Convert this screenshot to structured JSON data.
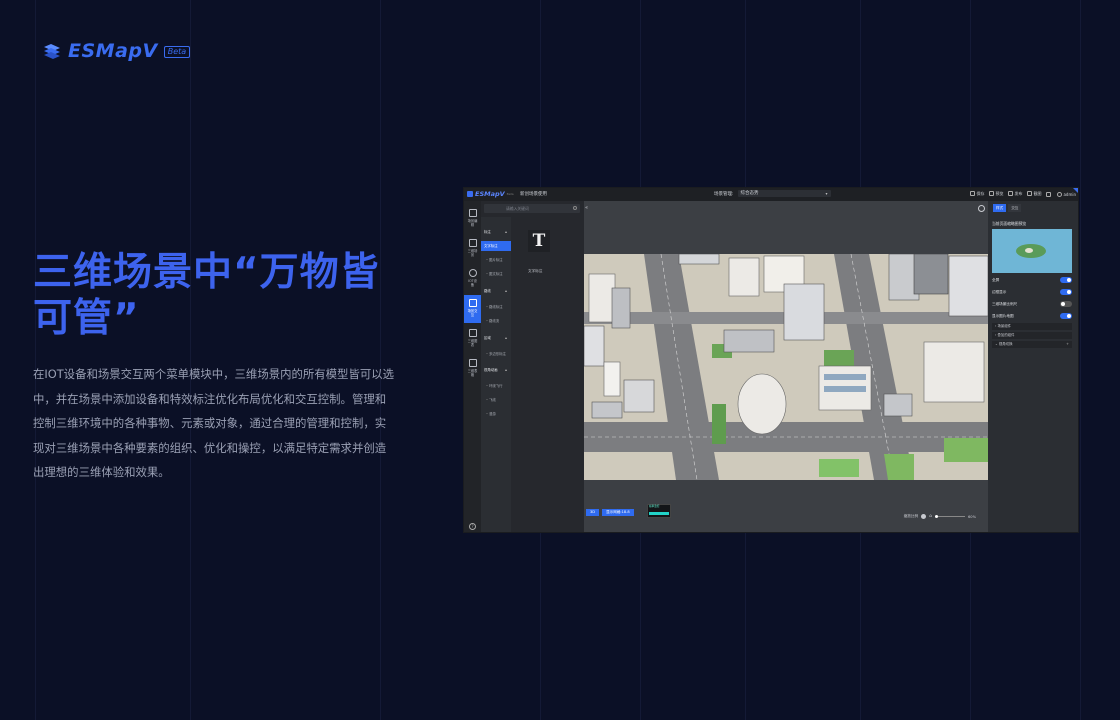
{
  "logo": {
    "name": "ESMapV",
    "badge": "Beta"
  },
  "headline": "三维场景中“万物皆可管”",
  "description": "在IOT设备和场景交互两个菜单模块中，三维场景内的所有模型皆可以选中，并在场景中添加设备和特效标注优化布局优化和交互控制。管理和控制三维环境中的各种事物、元素或对象，通过合理的管理和控制，实现对三维场景中各种要素的组织、优化和操控，以满足特定需求并创造出理想的三维体验和效果。",
  "colors": {
    "background": "#0b1026",
    "accent": "#3d63ee",
    "app_accent": "#2f6bf0"
  },
  "app": {
    "topbar": {
      "logo": "ESMapV",
      "logo_badge": "Beta",
      "project_title": "新创场景使用",
      "scene_label": "场景管理:",
      "scene_value": "综合态势",
      "actions": [
        {
          "icon": "save-icon",
          "label": "保存"
        },
        {
          "icon": "preview-icon",
          "label": "预览"
        },
        {
          "icon": "publish-icon",
          "label": "发布"
        },
        {
          "icon": "screenshot-icon",
          "label": "截图"
        },
        {
          "icon": "download-icon",
          "label": ""
        },
        {
          "icon": "user-icon",
          "label": "admin"
        }
      ]
    },
    "sidebar": [
      {
        "icon": "scene-icon",
        "label": "场景编辑"
      },
      {
        "icon": "building-icon",
        "label": "三维场景"
      },
      {
        "icon": "iot-icon",
        "label": "IOT设备"
      },
      {
        "icon": "interaction-icon",
        "label": "场景交互",
        "active": true
      },
      {
        "icon": "chart-icon",
        "label": "三维图表"
      },
      {
        "icon": "table-icon",
        "label": "三维表格"
      }
    ],
    "panel": {
      "search_placeholder": "请输入关键词",
      "tree": [
        {
          "label": "标注",
          "type": "group"
        },
        {
          "label": "文字标注",
          "type": "selected"
        },
        {
          "label": "图片标注",
          "type": "sub"
        },
        {
          "label": "图文标注",
          "type": "sub"
        },
        {
          "label": "路线",
          "type": "group"
        },
        {
          "label": "路线标注",
          "type": "sub"
        },
        {
          "label": "路线流",
          "type": "sub"
        },
        {
          "label": "区域",
          "type": "group"
        },
        {
          "label": "多边形标注",
          "type": "sub"
        },
        {
          "label": "视角动画",
          "type": "group"
        },
        {
          "label": "环绕飞行",
          "type": "sub"
        },
        {
          "label": "飞线",
          "type": "sub"
        },
        {
          "label": "漫游",
          "type": "sub"
        }
      ],
      "tile_glyph": "T",
      "tile_label": "文字标注"
    },
    "viewport": {
      "buttons": [
        "3D",
        "显示网格:18.8"
      ],
      "mini_label": "帧率监控",
      "zoom_label": "缩放比例",
      "zoom_value": "60%"
    },
    "rpanel": {
      "tabs": [
        "样式",
        "交互"
      ],
      "preview_label": "当前页面缩略图预览",
      "switches": [
        {
          "label": "全屏",
          "on": true
        },
        {
          "label": "边框显示",
          "on": true
        },
        {
          "label": "三维场景比例尺",
          "on": false
        },
        {
          "label": "显示图片地图",
          "on": true
        }
      ],
      "folds": [
        "场景组件",
        "叠加的组件",
        "视角切换"
      ]
    }
  }
}
